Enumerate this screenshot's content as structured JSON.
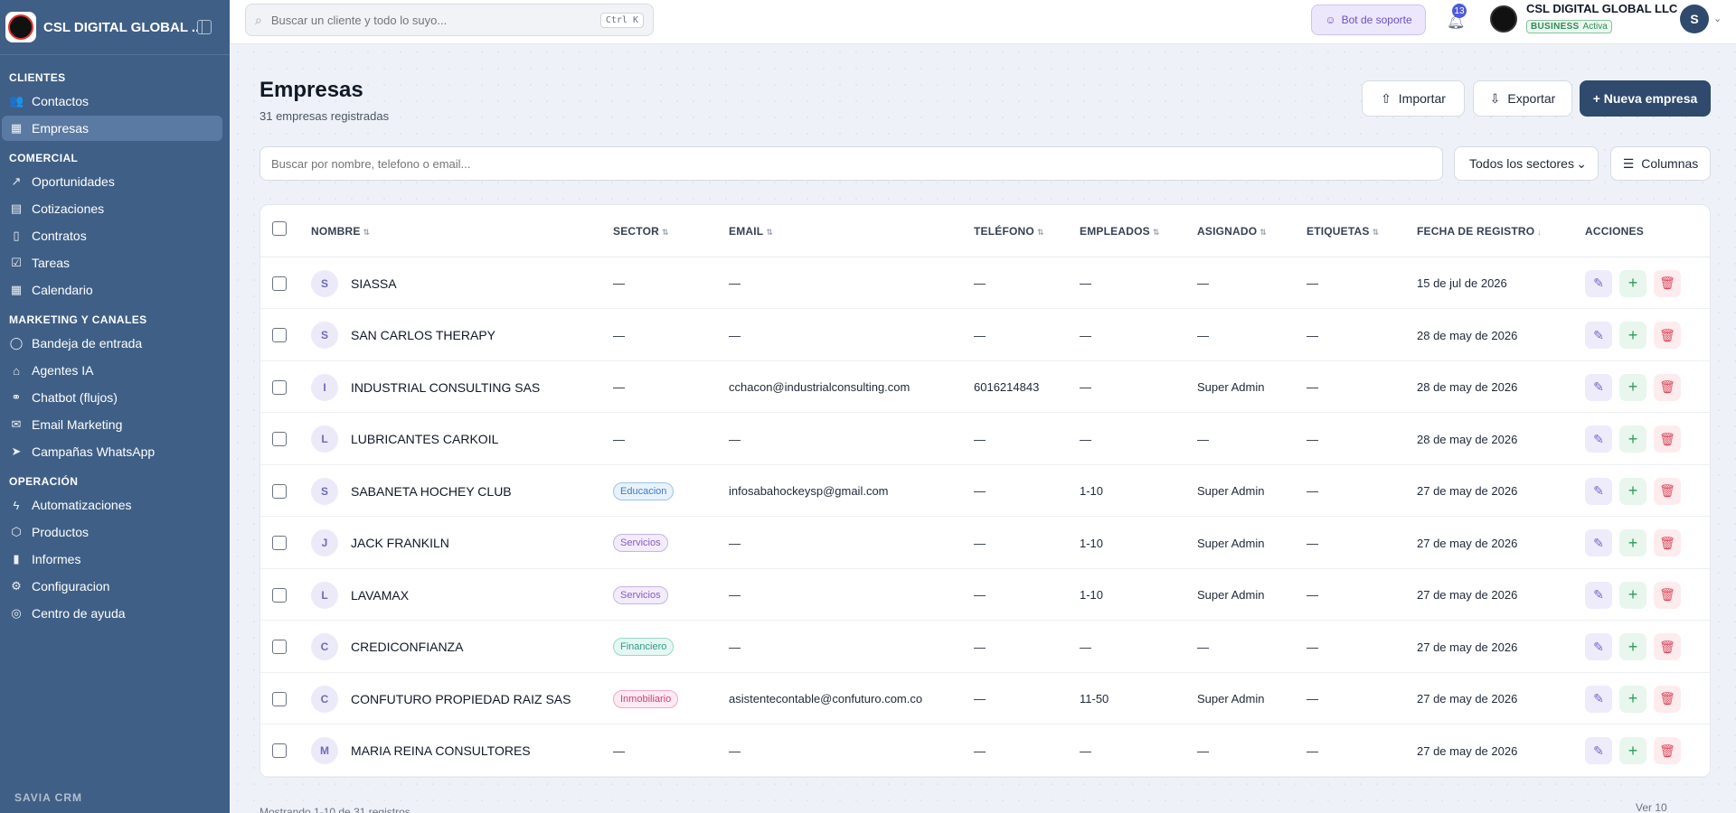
{
  "sidebar": {
    "brand": "CSL DIGITAL GLOBAL ...",
    "sections": [
      {
        "title": "CLIENTES",
        "items": [
          {
            "label": "Contactos",
            "icon": "users-icon",
            "glyph": "👥"
          },
          {
            "label": "Empresas",
            "icon": "building-icon",
            "glyph": "▦",
            "active": true
          }
        ]
      },
      {
        "title": "COMERCIAL",
        "items": [
          {
            "label": "Oportunidades",
            "icon": "trend-up-icon",
            "glyph": "↗"
          },
          {
            "label": "Cotizaciones",
            "icon": "file-text-icon",
            "glyph": "▤"
          },
          {
            "label": "Contratos",
            "icon": "file-icon",
            "glyph": "▯"
          },
          {
            "label": "Tareas",
            "icon": "check-square-icon",
            "glyph": "☑"
          },
          {
            "label": "Calendario",
            "icon": "calendar-icon",
            "glyph": "▦"
          }
        ]
      },
      {
        "title": "MARKETING Y CANALES",
        "items": [
          {
            "label": "Bandeja de entrada",
            "icon": "message-circle-icon",
            "glyph": "◯"
          },
          {
            "label": "Agentes IA",
            "icon": "bot-icon",
            "glyph": "⌂"
          },
          {
            "label": "Chatbot (flujos)",
            "icon": "workflow-icon",
            "glyph": "⚭"
          },
          {
            "label": "Email Marketing",
            "icon": "mail-icon",
            "glyph": "✉"
          },
          {
            "label": "Campañas WhatsApp",
            "icon": "send-icon",
            "glyph": "➤"
          }
        ]
      },
      {
        "title": "OPERACIÓN",
        "items": [
          {
            "label": "Automatizaciones",
            "icon": "zap-icon",
            "glyph": "ϟ"
          },
          {
            "label": "Productos",
            "icon": "package-icon",
            "glyph": "⬡"
          },
          {
            "label": "Informes",
            "icon": "bar-chart-icon",
            "glyph": "▮"
          },
          {
            "label": "Configuracion",
            "icon": "gear-icon",
            "glyph": "⚙"
          },
          {
            "label": "Centro de ayuda",
            "icon": "help-circle-icon",
            "glyph": "◎"
          }
        ]
      }
    ],
    "footer": "SAVIA CRM"
  },
  "topbar": {
    "search_placeholder": "Buscar un cliente y todo lo suyo...",
    "search_shortcut": "Ctrl K",
    "bot_label": "Bot de soporte",
    "notifications_count": "13",
    "org_name": "CSL DIGITAL GLOBAL LLC",
    "plan": "BUSINESS",
    "plan_status": "Activa",
    "user_initial": "S"
  },
  "page": {
    "title": "Empresas",
    "subtitle": "31 empresas registradas",
    "import_label": "Importar",
    "export_label": "Exportar",
    "new_label": "+ Nueva empresa",
    "table_search_placeholder": "Buscar por nombre, telefono o email...",
    "sector_filter": "Todos los sectores",
    "columns_label": "Columnas"
  },
  "table": {
    "headers": {
      "nombre": "NOMBRE",
      "sector": "SECTOR",
      "email": "EMAIL",
      "telefono": "TELÉFONO",
      "empleados": "EMPLEADOS",
      "asignado": "ASIGNADO",
      "etiquetas": "ETIQUETAS",
      "fecha": "FECHA DE REGISTRO",
      "acciones": "ACCIONES"
    },
    "rows": [
      {
        "initial": "S",
        "name": "SIASSA",
        "sector": "—",
        "sector_badge": "",
        "email": "—",
        "phone": "—",
        "employees": "—",
        "assigned": "—",
        "tags": "—",
        "date": "15 de jul de 2026"
      },
      {
        "initial": "S",
        "name": "SAN CARLOS THERAPY",
        "sector": "—",
        "sector_badge": "",
        "email": "—",
        "phone": "—",
        "employees": "—",
        "assigned": "—",
        "tags": "—",
        "date": "28 de may de 2026"
      },
      {
        "initial": "I",
        "name": "INDUSTRIAL CONSULTING SAS",
        "sector": "—",
        "sector_badge": "",
        "email": "cchacon@industrialconsulting.com",
        "phone": "6016214843",
        "employees": "—",
        "assigned": "Super Admin",
        "tags": "—",
        "date": "28 de may de 2026"
      },
      {
        "initial": "L",
        "name": "LUBRICANTES CARKOIL",
        "sector": "—",
        "sector_badge": "",
        "email": "—",
        "phone": "—",
        "employees": "—",
        "assigned": "—",
        "tags": "—",
        "date": "28 de may de 2026"
      },
      {
        "initial": "S",
        "name": "SABANETA HOCHEY CLUB",
        "sector": "Educacion",
        "sector_badge": "b-educ",
        "email": "infosabahockeysp@gmail.com",
        "phone": "—",
        "employees": "1-10",
        "assigned": "Super Admin",
        "tags": "—",
        "date": "27 de may de 2026"
      },
      {
        "initial": "J",
        "name": "JACK FRANKILN",
        "sector": "Servicios",
        "sector_badge": "b-serv",
        "email": "—",
        "phone": "—",
        "employees": "1-10",
        "assigned": "Super Admin",
        "tags": "—",
        "date": "27 de may de 2026"
      },
      {
        "initial": "L",
        "name": "LAVAMAX",
        "sector": "Servicios",
        "sector_badge": "b-serv",
        "email": "—",
        "phone": "—",
        "employees": "1-10",
        "assigned": "Super Admin",
        "tags": "—",
        "date": "27 de may de 2026"
      },
      {
        "initial": "C",
        "name": "CREDICONFIANZA",
        "sector": "Financiero",
        "sector_badge": "b-fin",
        "email": "—",
        "phone": "—",
        "employees": "—",
        "assigned": "—",
        "tags": "—",
        "date": "27 de may de 2026"
      },
      {
        "initial": "C",
        "name": "CONFUTURO PROPIEDAD RAIZ SAS",
        "sector": "Inmobiliario",
        "sector_badge": "b-inm",
        "email": "asistentecontable@confuturo.com.co",
        "phone": "—",
        "employees": "11-50",
        "assigned": "Super Admin",
        "tags": "—",
        "date": "27 de may de 2026"
      },
      {
        "initial": "M",
        "name": "MARIA REINA CONSULTORES",
        "sector": "—",
        "sector_badge": "",
        "email": "—",
        "phone": "—",
        "employees": "—",
        "assigned": "—",
        "tags": "—",
        "date": "27 de may de 2026"
      }
    ]
  },
  "pagination": {
    "summary": "Mostrando 1-10 de 31 registros",
    "per_page_label": "Ver",
    "per_page_value": "10"
  }
}
